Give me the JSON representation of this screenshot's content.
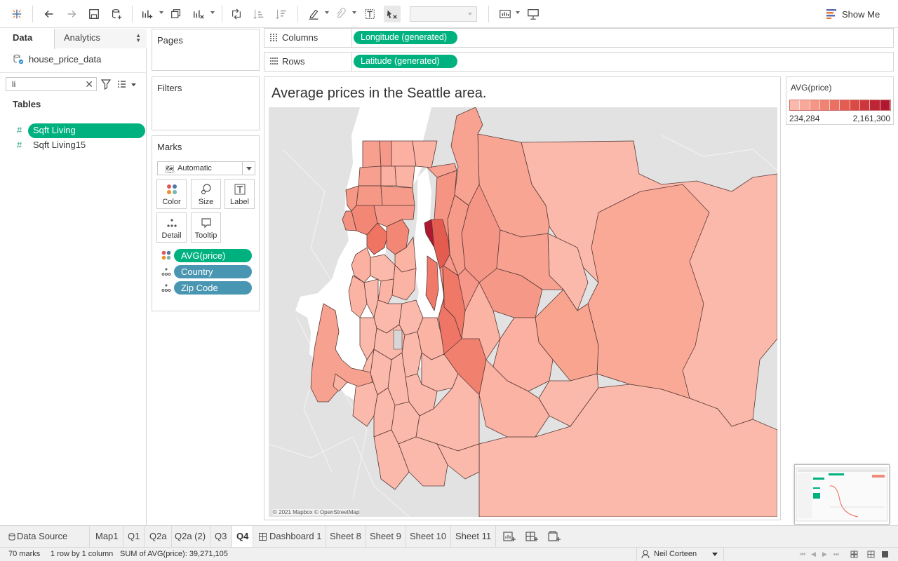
{
  "toolbar": {
    "show_me_label": "Show Me"
  },
  "data_pane": {
    "tab_data": "Data",
    "tab_analytics": "Analytics",
    "data_source": "house_price_data",
    "search_value": "li",
    "tables_heading": "Tables",
    "fields": [
      {
        "label": "Sqft Living",
        "selected": true
      },
      {
        "label": "Sqft Living15",
        "selected": false
      }
    ]
  },
  "pages": {
    "title": "Pages"
  },
  "filters": {
    "title": "Filters"
  },
  "marks": {
    "title": "Marks",
    "type": "Automatic",
    "cards": [
      "Color",
      "Size",
      "Label",
      "Detail",
      "Tooltip"
    ],
    "pills": [
      {
        "label": "AVG(price)",
        "color": "#00b180"
      },
      {
        "label": "Country",
        "color": "#4996b2"
      },
      {
        "label": "Zip Code",
        "color": "#4996b2"
      }
    ]
  },
  "shelves": {
    "columns_label": "Columns",
    "columns_pill": "Longitude (generated)",
    "rows_label": "Rows",
    "rows_pill": "Latitude (generated)"
  },
  "view": {
    "title": "Average prices in the Seattle area.",
    "attribution": "© 2021 Mapbox © OpenStreetMap"
  },
  "legend": {
    "title": "AVG(price)",
    "min": "234,284",
    "max": "2,161,300",
    "colors": [
      "#fbb9ab",
      "#f8a898",
      "#f49685",
      "#ef8473",
      "#ea7161",
      "#e35e51",
      "#d94a44",
      "#cd373b",
      "#bf2635",
      "#b01832"
    ]
  },
  "sheet_tabs": {
    "data_source": "Data Source",
    "sheets": [
      {
        "label": "Map1",
        "active": false
      },
      {
        "label": "Q1",
        "active": false
      },
      {
        "label": "Q2a",
        "active": false
      },
      {
        "label": "Q2a (2)",
        "active": false
      },
      {
        "label": "Q3",
        "active": false
      },
      {
        "label": "Q4",
        "active": true
      },
      {
        "label": "Dashboard 1",
        "active": false
      },
      {
        "label": "Sheet 8",
        "active": false
      },
      {
        "label": "Sheet 9",
        "active": false
      },
      {
        "label": "Sheet 10",
        "active": false
      },
      {
        "label": "Sheet 11",
        "active": false
      }
    ]
  },
  "status": {
    "marks": "70 marks",
    "dims": "1 row by 1 column",
    "sum": "SUM of AVG(price): 39,271,105",
    "user": "Neil Corteen"
  }
}
